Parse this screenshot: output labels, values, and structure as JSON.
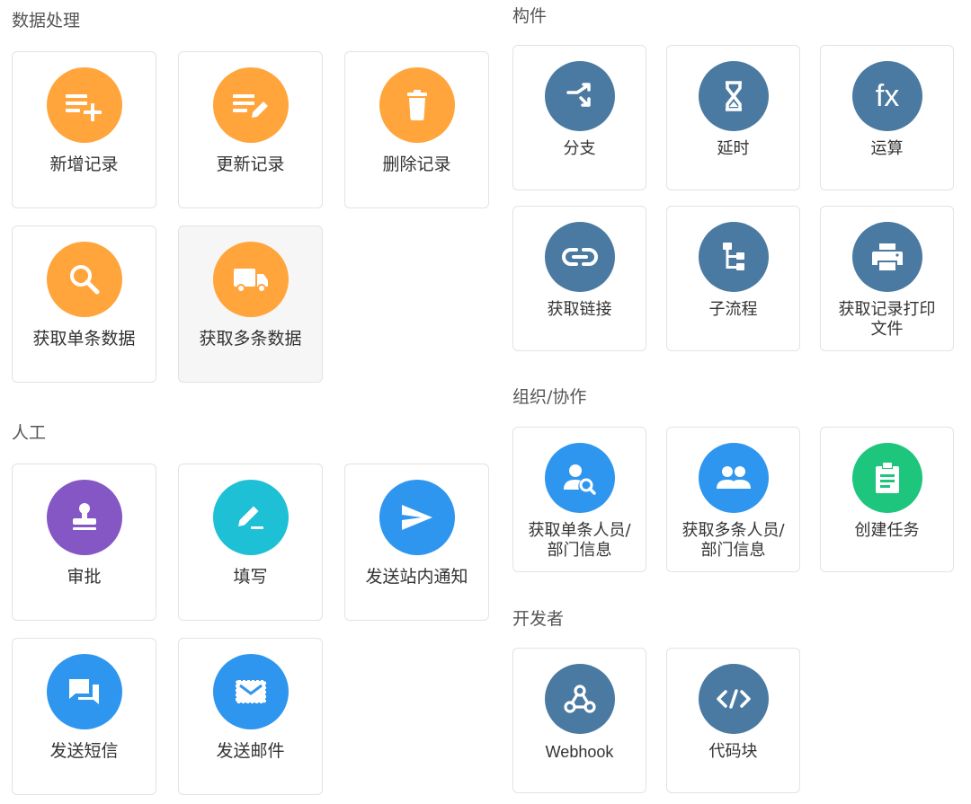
{
  "colors": {
    "orange": "#ffa53c",
    "purple": "#8457c4",
    "teal": "#1ec0d6",
    "blue": "#2f96ef",
    "slate": "#4a7aa1",
    "green": "#1ec57c"
  },
  "sections": {
    "data_processing": {
      "title": "数据处理",
      "items": [
        {
          "label": "新增记录",
          "icon": "add-record-icon"
        },
        {
          "label": "更新记录",
          "icon": "edit-record-icon"
        },
        {
          "label": "删除记录",
          "icon": "trash-icon"
        },
        {
          "label": "获取单条数据",
          "icon": "search-icon"
        },
        {
          "label": "获取多条数据",
          "icon": "truck-icon"
        }
      ]
    },
    "manual": {
      "title": "人工",
      "items": [
        {
          "label": "审批",
          "icon": "stamp-icon"
        },
        {
          "label": "填写",
          "icon": "pencil-icon"
        },
        {
          "label": "发送站内通知",
          "icon": "send-icon"
        },
        {
          "label": "发送短信",
          "icon": "chat-icon"
        },
        {
          "label": "发送邮件",
          "icon": "mail-icon"
        }
      ]
    },
    "components": {
      "title": "构件",
      "items": [
        {
          "label": "分支",
          "icon": "shuffle-icon"
        },
        {
          "label": "延时",
          "icon": "hourglass-icon"
        },
        {
          "label": "运算",
          "icon": "fx-icon",
          "glyph": "fx"
        },
        {
          "label": "获取链接",
          "icon": "link-icon"
        },
        {
          "label": "子流程",
          "icon": "subflow-icon"
        },
        {
          "label": "获取记录打印\n文件",
          "icon": "printer-icon"
        }
      ]
    },
    "org": {
      "title": "组织/协作",
      "items": [
        {
          "label": "获取单条人员/\n部门信息",
          "icon": "person-search-icon"
        },
        {
          "label": "获取多条人员/\n部门信息",
          "icon": "people-icon"
        },
        {
          "label": "创建任务",
          "icon": "clipboard-icon"
        }
      ]
    },
    "developer": {
      "title": "开发者",
      "items": [
        {
          "label": "Webhook",
          "icon": "webhook-icon"
        },
        {
          "label": "代码块",
          "icon": "code-icon"
        }
      ]
    }
  }
}
